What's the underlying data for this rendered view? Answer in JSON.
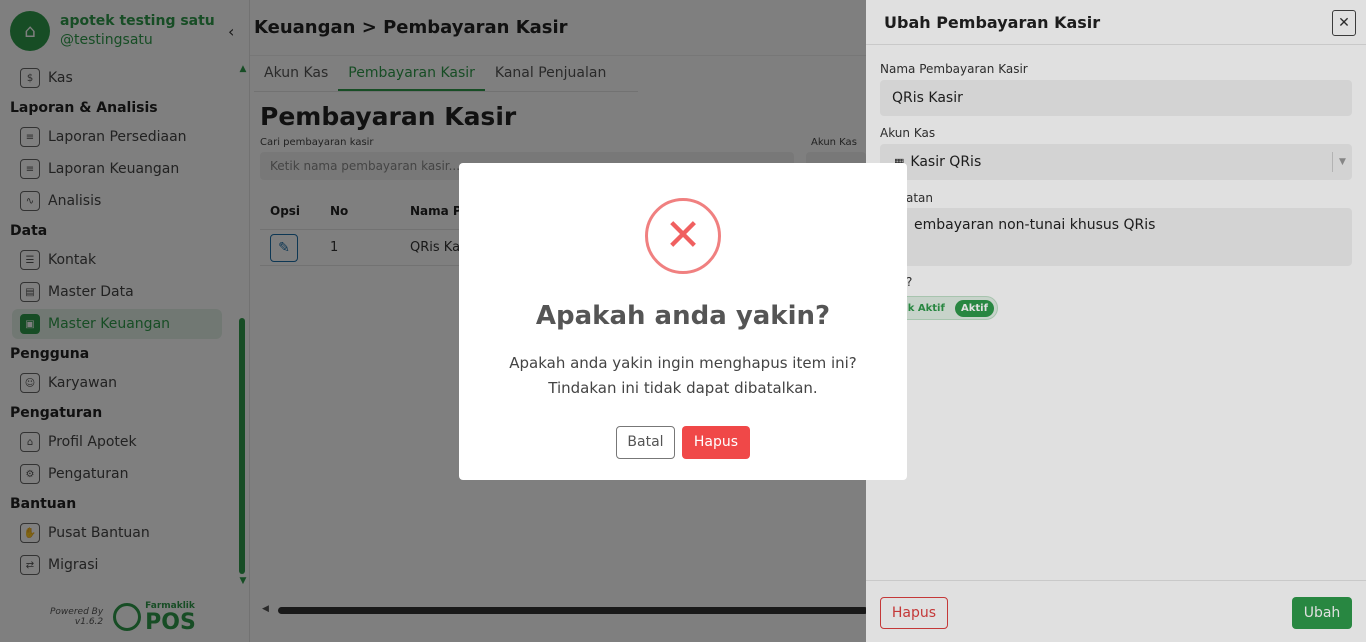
{
  "brand": {
    "name": "apotek testing satu",
    "username": "@testingsatu",
    "collapse_glyph": "‹"
  },
  "sidebar": {
    "items": [
      {
        "type": "item",
        "label": "Kas",
        "icon": "cash-icon"
      },
      {
        "type": "section",
        "label": "Laporan & Analisis"
      },
      {
        "type": "item",
        "label": "Laporan Persediaan",
        "icon": "clipboard-icon"
      },
      {
        "type": "item",
        "label": "Laporan Keuangan",
        "icon": "clipboard-icon"
      },
      {
        "type": "item",
        "label": "Analisis",
        "icon": "chart-icon"
      },
      {
        "type": "section",
        "label": "Data"
      },
      {
        "type": "item",
        "label": "Kontak",
        "icon": "contact-book-icon"
      },
      {
        "type": "item",
        "label": "Master Data",
        "icon": "database-icon"
      },
      {
        "type": "item",
        "label": "Master Keuangan",
        "icon": "wallet-icon",
        "active": true
      },
      {
        "type": "section",
        "label": "Pengguna"
      },
      {
        "type": "item",
        "label": "Karyawan",
        "icon": "users-icon"
      },
      {
        "type": "section",
        "label": "Pengaturan"
      },
      {
        "type": "item",
        "label": "Profil Apotek",
        "icon": "store-icon"
      },
      {
        "type": "item",
        "label": "Pengaturan",
        "icon": "gear-icon"
      },
      {
        "type": "section",
        "label": "Bantuan"
      },
      {
        "type": "item",
        "label": "Pusat Bantuan",
        "icon": "hand-icon"
      },
      {
        "type": "item",
        "label": "Migrasi",
        "icon": "migrate-icon"
      }
    ],
    "powered_by": "Powered By",
    "version": "v1.6.2",
    "product_small": "Farmaklik",
    "product_big": "POS"
  },
  "main": {
    "breadcrumb": "Keuangan > Pembayaran Kasir",
    "tabs": [
      {
        "label": "Akun Kas"
      },
      {
        "label": "Pembayaran Kasir",
        "active": true
      },
      {
        "label": "Kanal Penjualan"
      }
    ],
    "title": "Pembayaran Kasir",
    "search_label": "Cari pembayaran kasir",
    "search_placeholder": "Ketik nama pembayaran kasir...",
    "akun_label": "Akun Kas",
    "table": {
      "headers": [
        "Opsi",
        "No",
        "Nama P"
      ],
      "rows": [
        {
          "no": "1",
          "nama": "QRis Ka"
        }
      ]
    }
  },
  "drawer": {
    "title": "Ubah Pembayaran Kasir",
    "close_glyph": "✕",
    "fields": {
      "nama_label": "Nama Pembayaran Kasir",
      "nama_value": "QRis Kasir",
      "akun_label": "Akun Kas",
      "akun_value": "Kasir QRis",
      "catatan_label": "atan",
      "catatan_value": "embayaran non-tunai khusus QRis",
      "status_label": "?",
      "toggle_off": "ak Aktif",
      "toggle_on": "Aktif"
    },
    "delete_label": "Hapus",
    "submit_label": "Ubah"
  },
  "dialog": {
    "icon_glyph": "✕",
    "title": "Apakah anda yakin?",
    "line1": "Apakah anda yakin ingin menghapus item ini?",
    "line2": "Tindakan ini tidak dapat dibatalkan.",
    "cancel_label": "Batal",
    "confirm_label": "Hapus"
  },
  "colors": {
    "accent": "#2e9a4a",
    "danger": "#f04848"
  }
}
